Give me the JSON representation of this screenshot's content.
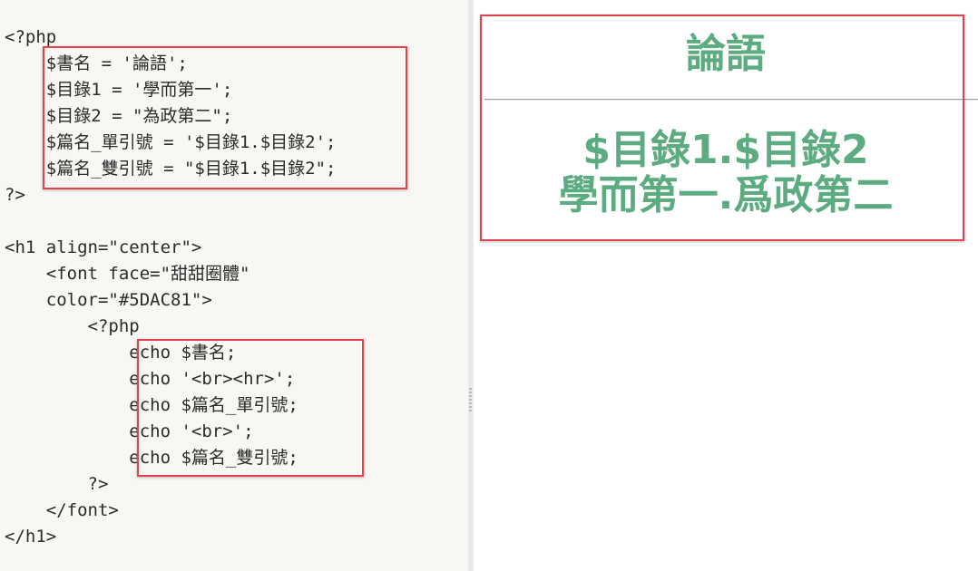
{
  "editor": {
    "lines": [
      "<?php",
      "    $書名 = '論語';",
      "    $目錄1 = '學而第一';",
      "    $目錄2 = \"為政第二\";",
      "    $篇名_單引號 = '$目錄1.$目錄2';",
      "    $篇名_雙引號 = \"$目錄1.$目錄2\";",
      "?>",
      "",
      "<h1 align=\"center\">",
      "    <font face=\"甜甜圈體\"",
      "    color=\"#5DAC81\">",
      "        <?php",
      "            echo $書名;",
      "            echo '<br><hr>';",
      "            echo $篇名_單引號;",
      "            echo '<br>';",
      "            echo $篇名_雙引號;",
      "        ?>",
      "    </font>",
      "</h1>"
    ],
    "highlight_color": "#e2434b"
  },
  "preview": {
    "title": "論語",
    "line1": "$目錄1.$目錄2",
    "line2": "學而第一.爲政第二",
    "text_color": "#5DAC81"
  }
}
